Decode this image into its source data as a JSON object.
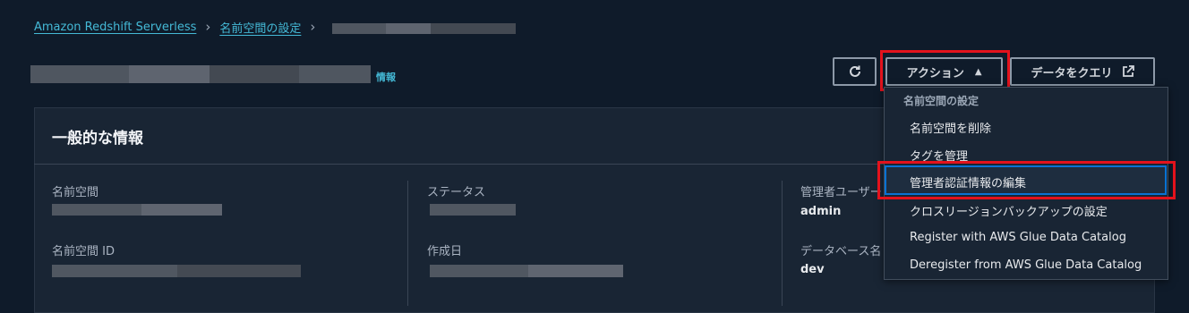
{
  "breadcrumb": {
    "items": [
      "Amazon Redshift Serverless",
      "名前空間の設定"
    ]
  },
  "header": {
    "info_link": "情報"
  },
  "toolbar": {
    "actions_label": "アクション",
    "query_label": "データをクエリ"
  },
  "panel": {
    "title": "一般的な情報",
    "fields": {
      "namespace_label": "名前空間",
      "namespace_id_label": "名前空間 ID",
      "status_label": "ステータス",
      "created_label": "作成日",
      "admin_user_label": "管理者ユーザー",
      "admin_user_value": "admin",
      "database_label": "データベース名",
      "database_value": "dev"
    }
  },
  "dropdown": {
    "group_label": "名前空間の設定",
    "items": [
      "名前空間を削除",
      "タグを管理",
      "管理者認証情報の編集",
      "クロスリージョンバックアップの設定",
      "Register with AWS Glue Data Catalog",
      "Deregister from AWS Glue Data Catalog"
    ]
  },
  "colors": {
    "background": "#0f1b2a",
    "panel": "#192534",
    "link": "#44b9d6",
    "highlight_border": "#e3121c",
    "focus_border": "#0972d3"
  }
}
